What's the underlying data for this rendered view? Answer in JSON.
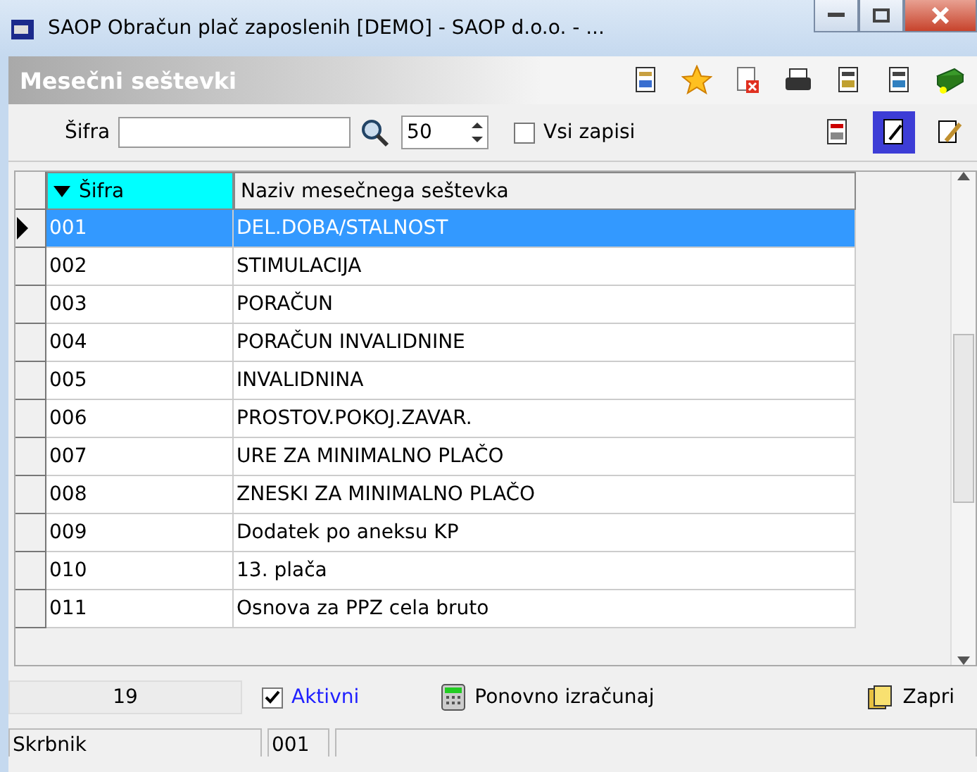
{
  "window": {
    "title": "SAOP Obračun plač zaposlenih [DEMO] - SAOP d.o.o. - ..."
  },
  "panel": {
    "title": "Mesečni seštevki"
  },
  "filter": {
    "label": "Šifra",
    "count": "50",
    "all_records": {
      "label": "Vsi zapisi",
      "checked": false
    }
  },
  "table": {
    "columns": [
      {
        "label": "Šifra",
        "sorted": true
      },
      {
        "label": "Naziv mesečnega seštevka",
        "sorted": false
      }
    ],
    "rows": [
      {
        "code": "001",
        "name": "DEL.DOBA/STALNOST",
        "selected": true
      },
      {
        "code": "002",
        "name": "STIMULACIJA",
        "selected": false
      },
      {
        "code": "003",
        "name": "PORAČUN",
        "selected": false
      },
      {
        "code": "004",
        "name": "PORAČUN INVALIDNINE",
        "selected": false
      },
      {
        "code": "005",
        "name": "INVALIDNINA",
        "selected": false
      },
      {
        "code": "006",
        "name": "PROSTOV.POKOJ.ZAVAR.",
        "selected": false
      },
      {
        "code": "007",
        "name": "URE ZA MINIMALNO PLAČO",
        "selected": false
      },
      {
        "code": "008",
        "name": "ZNESKI ZA MINIMALNO PLAČO",
        "selected": false
      },
      {
        "code": "009",
        "name": "Dodatek po aneksu KP",
        "selected": false
      },
      {
        "code": "010",
        "name": "13. plača",
        "selected": false
      },
      {
        "code": "011",
        "name": "Osnova za PPZ cela bruto",
        "selected": false
      }
    ]
  },
  "footer": {
    "count": "19",
    "active": {
      "label": "Aktivni",
      "checked": true
    },
    "recalc": "Ponovno izračunaj",
    "close": "Zapri"
  },
  "status_bar": [
    "Skrbnik",
    "001"
  ]
}
